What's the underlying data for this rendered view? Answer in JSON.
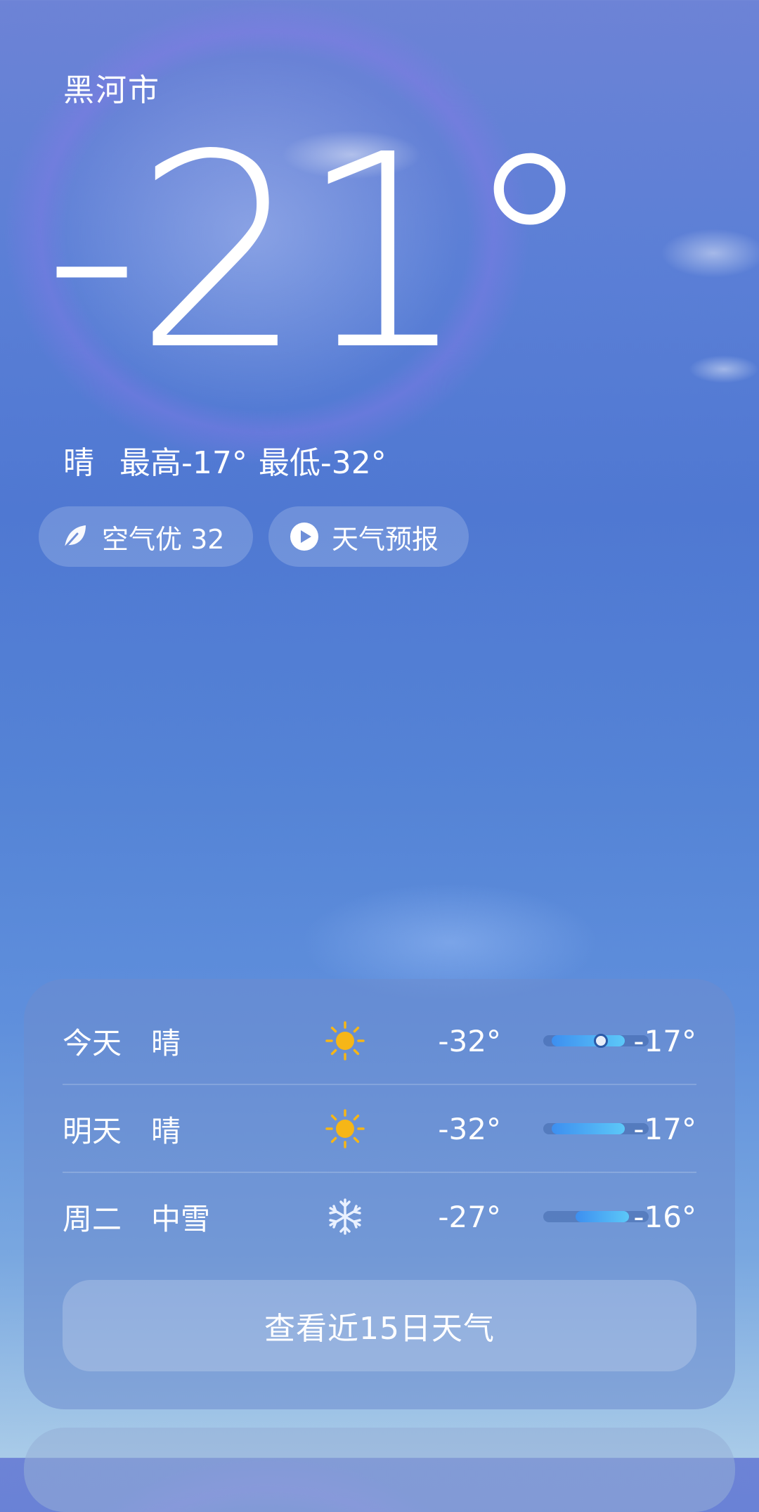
{
  "location": {
    "city": "黑河市"
  },
  "current": {
    "temperature": "-21°",
    "condition": "晴",
    "high": "最高-17°",
    "low": "最低-32°"
  },
  "chips": {
    "air_quality": "空气优 32",
    "forecast_video": "天气预报"
  },
  "forecast": {
    "days": [
      {
        "day": "今天",
        "condition": "晴",
        "icon": "sun-icon",
        "low": "-32°",
        "high": "-17°",
        "range_low": -32,
        "range_high": -17,
        "current": -21
      },
      {
        "day": "明天",
        "condition": "晴",
        "icon": "sun-icon",
        "low": "-32°",
        "high": "-17°",
        "range_low": -32,
        "range_high": -17
      },
      {
        "day": "周二",
        "condition": "中雪",
        "icon": "snowflake-icon",
        "low": "-27°",
        "high": "-16°",
        "range_low": -27,
        "range_high": -16
      }
    ],
    "more_button": "查看近15日天气"
  },
  "colors": {
    "sun": "#f6b617",
    "bar_fill_start": "#3d8ff0",
    "bar_fill_end": "#5cc8f8"
  }
}
